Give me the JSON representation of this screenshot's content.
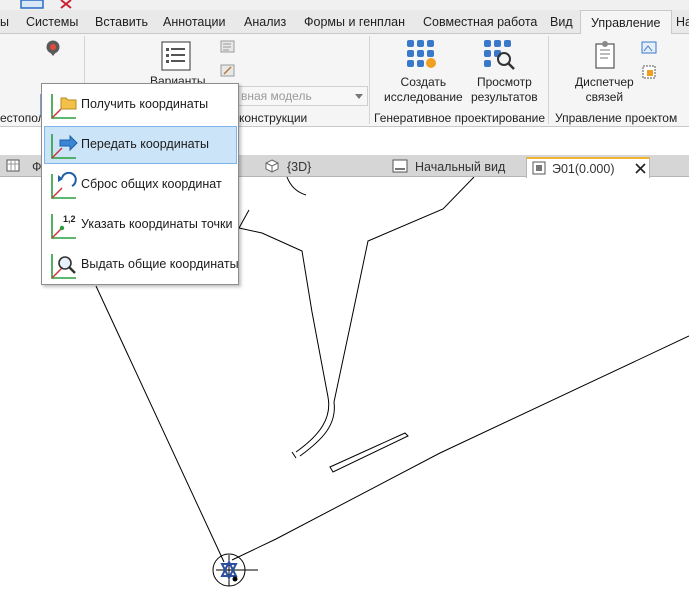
{
  "ribbon_tabs": [
    {
      "label": "ы"
    },
    {
      "label": "Системы"
    },
    {
      "label": "Вставить"
    },
    {
      "label": "Аннотации"
    },
    {
      "label": "Анализ"
    },
    {
      "label": "Формы и генплан"
    },
    {
      "label": "Совместная работа"
    },
    {
      "label": "Вид"
    },
    {
      "label": "Управление"
    },
    {
      "label": "На"
    }
  ],
  "ribbon": {
    "options_label": "Варианты",
    "design_model_placeholder": "вная модель",
    "create_study": {
      "line1": "Создать",
      "line2": "исследование"
    },
    "view_results": {
      "line1": "Просмотр",
      "line2": "результатов"
    },
    "link_manager": {
      "line1": "Диспетчер",
      "line2": "связей"
    },
    "panels": {
      "location_partial": "естопол",
      "design_options_partial": "конструкции",
      "generative_design": "Генеративное проектирование",
      "project_management": "Управление проектом"
    }
  },
  "coordinates_menu": {
    "items": [
      {
        "label": "Получить координаты",
        "icon": "acquire-coordinates-icon"
      },
      {
        "label": "Передать координаты",
        "icon": "publish-coordinates-icon"
      },
      {
        "label": "Сброс общих координат",
        "icon": "reset-shared-coordinates-icon"
      },
      {
        "label": "Указать координаты точки",
        "icon": "specify-point-coordinates-icon"
      },
      {
        "label": "Выдать общие координаты",
        "icon": "report-shared-coordinates-icon"
      }
    ],
    "highlighted_index": 1
  },
  "view_tabs": [
    {
      "label": "Ф"
    },
    {
      "label": "{3D}"
    },
    {
      "label": "Начальный вид"
    },
    {
      "label": "Э01(0.000)"
    }
  ],
  "colors": {
    "accent_blue": "#2b6cc4",
    "highlight_bg": "#cce4f7",
    "active_view_tab_border": "#f2b233",
    "axis_green": "#2a9d3c",
    "axis_red": "#d03030"
  }
}
